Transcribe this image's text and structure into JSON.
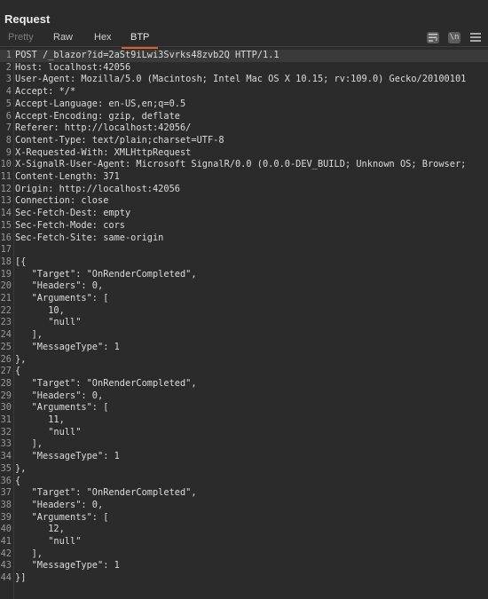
{
  "panel": {
    "title": "Request"
  },
  "tabs": [
    {
      "label": "Pretty",
      "state": "disabled"
    },
    {
      "label": "Raw",
      "state": "normal"
    },
    {
      "label": "Hex",
      "state": "normal"
    },
    {
      "label": "BTP",
      "state": "selected"
    }
  ],
  "toolbar": {
    "icons": [
      "wrap-lines-icon",
      "newline-toggle-icon",
      "hamburger-menu-icon"
    ],
    "newline_label": "\\n"
  },
  "colors": {
    "accent": "#e0602b",
    "background": "#2b2b2b",
    "text": "#dcdcdc"
  },
  "lines": [
    "POST /_blazor?id=2aSt9iLwi3Svrks48zvb2Q HTTP/1.1",
    "Host: localhost:42056",
    "User-Agent: Mozilla/5.0 (Macintosh; Intel Mac OS X 10.15; rv:109.0) Gecko/20100101",
    "Accept: */*",
    "Accept-Language: en-US,en;q=0.5",
    "Accept-Encoding: gzip, deflate",
    "Referer: http://localhost:42056/",
    "Content-Type: text/plain;charset=UTF-8",
    "X-Requested-With: XMLHttpRequest",
    "X-SignalR-User-Agent: Microsoft SignalR/0.0 (0.0.0-DEV_BUILD; Unknown OS; Browser;",
    "Content-Length: 371",
    "Origin: http://localhost:42056",
    "Connection: close",
    "Sec-Fetch-Dest: empty",
    "Sec-Fetch-Mode: cors",
    "Sec-Fetch-Site: same-origin",
    "",
    "[{",
    "   \"Target\": \"OnRenderCompleted\",",
    "   \"Headers\": 0,",
    "   \"Arguments\": [",
    "      10,",
    "      \"null\"",
    "   ],",
    "   \"MessageType\": 1",
    "},",
    "{",
    "   \"Target\": \"OnRenderCompleted\",",
    "   \"Headers\": 0,",
    "   \"Arguments\": [",
    "      11,",
    "      \"null\"",
    "   ],",
    "   \"MessageType\": 1",
    "},",
    "{",
    "   \"Target\": \"OnRenderCompleted\",",
    "   \"Headers\": 0,",
    "   \"Arguments\": [",
    "      12,",
    "      \"null\"",
    "   ],",
    "   \"MessageType\": 1",
    "}]"
  ]
}
